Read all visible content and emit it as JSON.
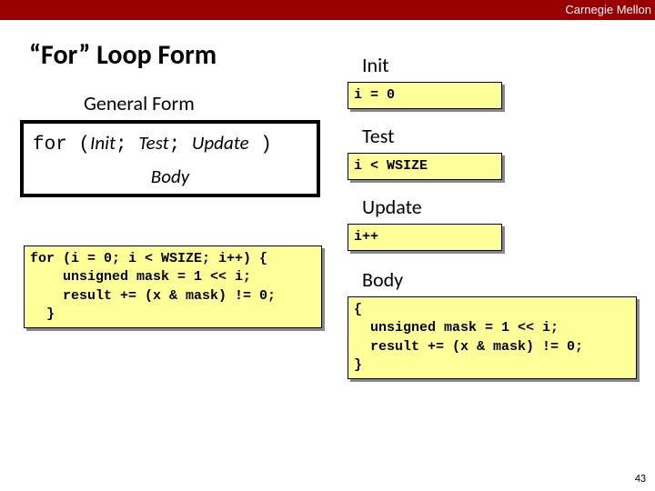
{
  "brand": "Carnegie Mellon",
  "title": "“For” Loop Form",
  "general_form_label": "General Form",
  "syntax": {
    "for_kw": "for",
    "open": " (",
    "init": "Init",
    "sep1": "; ",
    "test": "Test",
    "sep2": "; ",
    "update": "Update",
    "close": " )",
    "body": "Body"
  },
  "example_code": "for (i = 0; i < WSIZE; i++) {\n    unsigned mask = 1 << i;\n    result += (x & mask) != 0;\n  }",
  "right": {
    "init_label": "Init",
    "init_code": "i = 0",
    "test_label": "Test",
    "test_code": "i < WSIZE",
    "update_label": "Update",
    "update_code": "i++",
    "body_label": "Body",
    "body_code": "{\n  unsigned mask = 1 << i;\n  result += (x & mask) != 0;\n}"
  },
  "page_number": "43"
}
